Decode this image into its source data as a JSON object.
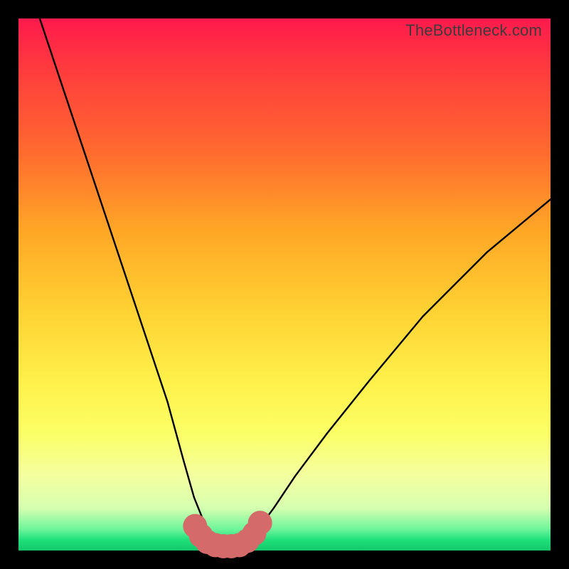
{
  "watermark": "TheBottleneck.com",
  "chart_data": {
    "type": "line",
    "title": "",
    "xlabel": "",
    "ylabel": "",
    "xlim": [
      0,
      100
    ],
    "ylim": [
      0,
      100
    ],
    "grid": false,
    "legend": false,
    "series": [
      {
        "name": "bottleneck-curve",
        "color": "#000000",
        "x": [
          4,
          8,
          12,
          16,
          20,
          24,
          28,
          31,
          33,
          35,
          37,
          39,
          41,
          43,
          45,
          48,
          52,
          58,
          66,
          76,
          88,
          100
        ],
        "y": [
          100,
          88,
          76,
          64,
          52,
          40,
          28,
          17,
          10,
          5,
          2,
          1,
          1,
          2,
          4,
          8,
          14,
          22,
          32,
          44,
          56,
          66
        ]
      },
      {
        "name": "trough-marker",
        "color": "#d46a6a",
        "x": [
          33.2,
          34.3,
          35.5,
          37.0,
          38.5,
          40.0,
          41.5,
          43.0,
          44.3,
          45.4
        ],
        "y": [
          4.6,
          2.8,
          1.6,
          1.0,
          0.8,
          0.8,
          1.0,
          1.8,
          3.2,
          5.2
        ]
      }
    ],
    "annotations": []
  }
}
